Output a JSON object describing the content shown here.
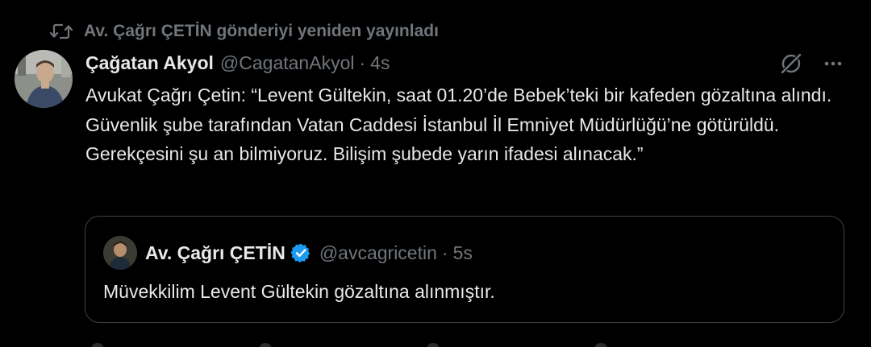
{
  "repost": {
    "label": "Av. Çağrı ÇETİN gönderiyi yeniden yayınladı",
    "icon": "repost-icon"
  },
  "tweet": {
    "display_name": "Çağatan Akyol",
    "handle": "@CagatanAkyol",
    "separator": "·",
    "time": "4s",
    "text": "Avukat Çağrı Çetin: “Levent Gültekin, saat 01.20’de Bebek’teki bir kafeden gözaltına alındı. Güvenlik şube tarafından Vatan Caddesi İstanbul İl Emniyet Müdürlüğü’ne götürüldü. Gerekçesini şu an bilmiyoruz. Bilişim şubede yarın ifadesi alınacak.”",
    "actions": {
      "grok_icon": "grok-icon",
      "more_icon": "more-icon"
    }
  },
  "quote": {
    "display_name": "Av. Çağrı ÇETİN",
    "verified": true,
    "handle": "@avcagricetin",
    "separator": "·",
    "time": "5s",
    "text": "Müvekkilim Levent Gültekin gözaltına alınmıştır."
  },
  "colors": {
    "background": "#000000",
    "primary_text": "#e7e9ea",
    "secondary_text": "#71767b",
    "border": "#3e4144",
    "verified_blue": "#1d9bf0"
  }
}
